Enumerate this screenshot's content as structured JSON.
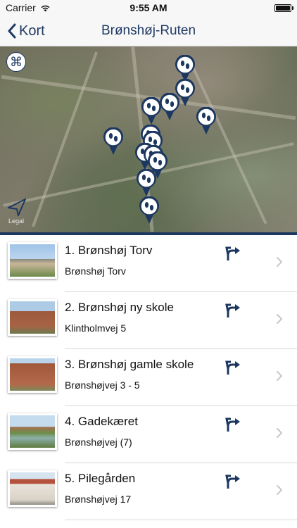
{
  "status_bar": {
    "carrier": "Carrier",
    "time": "9:55 AM",
    "battery_level": 1.0
  },
  "nav": {
    "back_label": "Kort",
    "title": "Brønshøj-Ruten"
  },
  "map": {
    "layers_icon": "command-icon",
    "locate_icon": "location-arrow-icon",
    "legal_label": "Legal",
    "pin_icon": "footprints-pin-icon",
    "pin_count": 13
  },
  "locations": [
    {
      "title": "1. Brønshøj Torv",
      "subtitle": "Brønshøj Torv"
    },
    {
      "title": "2. Brønshøj ny skole",
      "subtitle": "Klintholmvej 5"
    },
    {
      "title": "3. Brønshøj gamle skole",
      "subtitle": "Brønshøjvej 3 - 5"
    },
    {
      "title": "4. Gadekæret",
      "subtitle": "Brønshøjvej (7)"
    },
    {
      "title": "5. Pilegården",
      "subtitle": "Brønshøjvej 17"
    }
  ],
  "colors": {
    "accent": "#1c3760"
  }
}
